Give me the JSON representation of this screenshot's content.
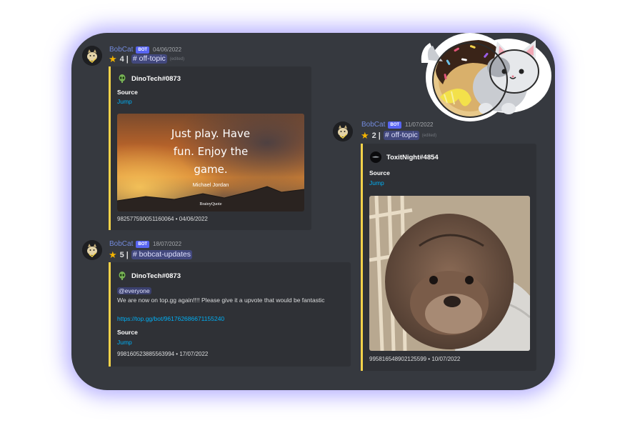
{
  "colors": {
    "panel_bg": "#36393f",
    "embed_bg": "#2f3136",
    "embed_accent": "#f3d24a",
    "username": "#7289da",
    "link": "#00aff4",
    "bot_tag": "#5865f2",
    "glow": "#7f76ff"
  },
  "messages": [
    {
      "username": "BobCat",
      "bot_tag": "BOT",
      "timestamp": "04/06/2022",
      "star_icon": "star-icon",
      "star_count": "4",
      "separator": "|",
      "channel": "# off-topic",
      "edited": "(edited)",
      "embed": {
        "author_icon": "alien-icon",
        "author": "DinoTech#0873",
        "field_name": "Source",
        "field_value": "Jump",
        "image": {
          "quote_lines": [
            "Just play. Have",
            "fun. Enjoy the",
            "game."
          ],
          "quote_author": "Michael Jordan",
          "brand": "BrainyQuote"
        },
        "footer": "982577590051160064 • 04/06/2022"
      }
    },
    {
      "username": "BobCat",
      "bot_tag": "BOT",
      "timestamp": "11/07/2022",
      "star_icon": "star-icon",
      "star_count": "2",
      "separator": "|",
      "channel": "# off-topic",
      "edited": "(edited)",
      "embed": {
        "author_icon": "dark-avatar-icon",
        "author": "ToxitNight#4854",
        "field_name": "Source",
        "field_value": "Jump",
        "image": {
          "subject": "otter-photo"
        },
        "footer": "995816548902125599 • 10/07/2022"
      }
    },
    {
      "username": "BobCat",
      "bot_tag": "BOT",
      "timestamp": "18/07/2022",
      "star_icon": "star-icon",
      "star_count": "5",
      "separator": "|",
      "channel": "# bobcat-updates",
      "embed": {
        "author_icon": "alien-icon",
        "author": "DinoTech#0873",
        "mention": "@everyone",
        "text": "We are now on top.gg again!!!! Please give it a upvote that would be fantastic",
        "url": "https://top.gg/bot/961762686671155240",
        "field_name": "Source",
        "field_value": "Jump",
        "footer": "998160523885563994 • 17/07/2022"
      }
    }
  ],
  "sticker": {
    "icon": "cat-donut-sticker-icon"
  }
}
